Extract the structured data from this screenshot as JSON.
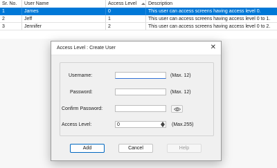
{
  "grid": {
    "headers": [
      "Sr. No.",
      "User Name",
      "Access Level",
      "Description"
    ],
    "rows": [
      [
        "1",
        "James",
        "0",
        "This user can access screens having access level 0."
      ],
      [
        "2",
        "Jeff",
        "1",
        "This user can access screens having access level 0 to 1."
      ],
      [
        "3",
        "Jennifer",
        "2",
        "This user can access screens having access level 0 to 2."
      ]
    ],
    "selected_row": 1,
    "sort_column": "Access Level",
    "sort_direction": "ascending"
  },
  "dialog": {
    "title": "Access Level : Create User",
    "close_glyph": "✕",
    "fields": {
      "username": {
        "label": "Username:",
        "value": "",
        "hint": "(Max. 12)"
      },
      "password": {
        "label": "Password:",
        "value": "",
        "hint": "(Max. 12)"
      },
      "confirm_password": {
        "label": "Confirm Password:",
        "value": ""
      },
      "access_level": {
        "label": "Access Level:",
        "value": "0",
        "hint": "(Max.255)"
      }
    },
    "icons": {
      "reveal": "eye-icon",
      "spin_up": "caret-up-icon",
      "spin_down": "caret-down-icon"
    },
    "buttons": {
      "add": "Add",
      "cancel": "Cancel",
      "help": "Help"
    }
  },
  "colors": {
    "selection": "#0078d7",
    "focus": "#2f6fd6",
    "primary_border": "#0067c0"
  }
}
